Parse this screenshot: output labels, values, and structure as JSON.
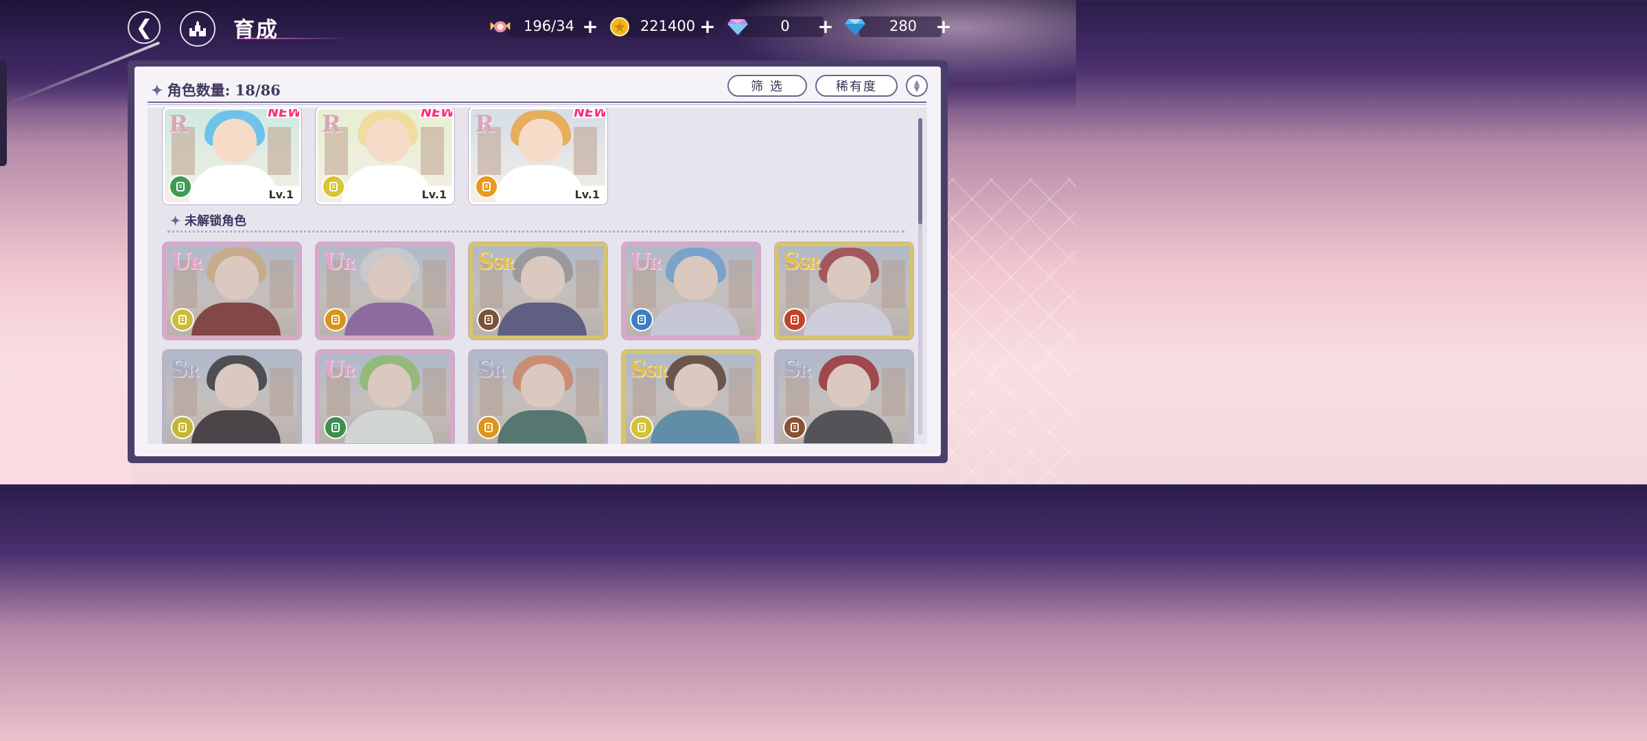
{
  "header": {
    "title": "育成",
    "resources": [
      {
        "icon": "candy-icon",
        "value": "196/34"
      },
      {
        "icon": "gold-coin-icon",
        "value": "221400"
      },
      {
        "icon": "rainbow-gem-icon",
        "value": "0"
      },
      {
        "icon": "blue-diamond-icon",
        "value": "280"
      }
    ],
    "plus": "+"
  },
  "panel": {
    "count_label": "角色数量: 18/86",
    "filter_label": "筛 选",
    "rarity_label": "稀有度",
    "locked_section": "未解锁角色"
  },
  "owned_cards": [
    {
      "rarity": "R",
      "level": "Lv.1",
      "new": "NEW",
      "role_color": "#3f9b52",
      "hair": "#6fc3ea",
      "bg": "#cfe9e0"
    },
    {
      "rarity": "R",
      "level": "Lv.1",
      "new": "NEW",
      "role_color": "#d9c431",
      "hair": "#f1dca0",
      "bg": "#e6efd2"
    },
    {
      "rarity": "R",
      "level": "Lv.1",
      "new": "NEW",
      "role_color": "#e79a1c",
      "hair": "#e6ad5c",
      "bg": "#d5dde8"
    }
  ],
  "locked_cards": [
    {
      "rarity": "UR",
      "role_color": "#cdbb3a",
      "hair": "#d9b583",
      "outfit": "#7a2a22",
      "frame": "#d8a8c8"
    },
    {
      "rarity": "UR",
      "role_color": "#d9941b",
      "hair": "#dcdcdc",
      "outfit": "#8a5c9c",
      "frame": "#d8a8c8"
    },
    {
      "rarity": "SSR",
      "role_color": "#7a5438",
      "hair": "#9a9a9a",
      "outfit": "#4a4a72",
      "frame": "#d6c46a"
    },
    {
      "rarity": "UR",
      "role_color": "#3b7fc4",
      "hair": "#6ea8d8",
      "outfit": "#d8d8e6",
      "frame": "#d8a8c8"
    },
    {
      "rarity": "SSR",
      "role_color": "#c2432a",
      "hair": "#a84040",
      "outfit": "#e2e2ec",
      "frame": "#d6c46a"
    },
    {
      "rarity": "SR",
      "role_color": "#c6b532",
      "hair": "#333333",
      "outfit": "#2e2624",
      "frame": "#b6b6c6"
    },
    {
      "rarity": "UR",
      "role_color": "#3c8f4e",
      "hair": "#93c86a",
      "outfit": "#e8efe4",
      "frame": "#d8a8c8"
    },
    {
      "rarity": "SR",
      "role_color": "#dc961c",
      "hair": "#e08860",
      "outfit": "#3c6a5c",
      "frame": "#b6b6c6"
    },
    {
      "rarity": "SSR",
      "role_color": "#d4c234",
      "hair": "#5c3c28",
      "outfit": "#4c8aa8",
      "frame": "#d6c46a"
    },
    {
      "rarity": "SR",
      "role_color": "#8a5234",
      "hair": "#a32a2a",
      "outfit": "#3a3a3a",
      "frame": "#b6b6c6"
    }
  ],
  "rarity_colors": {
    "R": "#d9a6b8",
    "SR": "#a7a9c6",
    "SSR": "#e3c04c",
    "UR": "#e7a2cd"
  }
}
